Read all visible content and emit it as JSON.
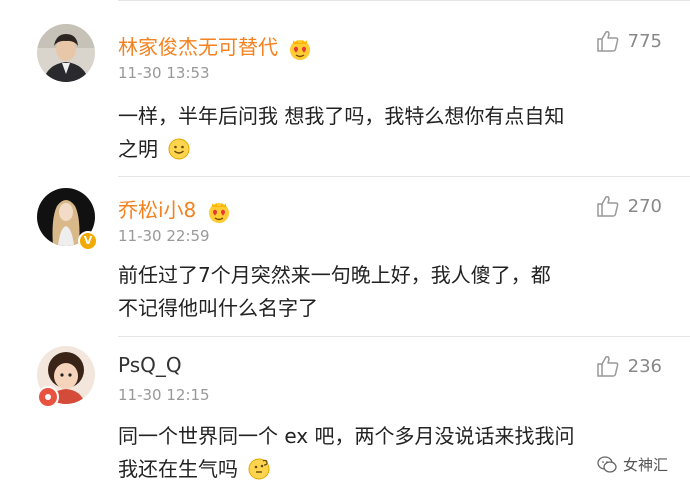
{
  "comments": [
    {
      "username": "林家俊杰无可替代",
      "timestamp": "11-30 13:53",
      "likes": "775",
      "lines": [
        "一样，半年后问我 想我了吗，我特么想你有点自知",
        "之明"
      ],
      "badge_icon": "heart-eyes-emoji-icon",
      "emoji_icon": "smile-emoji-icon",
      "avatar_icon": "user-photo-avatar"
    },
    {
      "username": "乔松i小8",
      "timestamp": "11-30 22:59",
      "likes": "270",
      "lines": [
        "前任过了7个月突然来一句晚上好，我人傻了，都",
        "不记得他叫什么名字了"
      ],
      "badge_icon": "heart-eyes-emoji-icon",
      "verified_badge": "V",
      "avatar_icon": "user-photo-avatar"
    },
    {
      "username": "PsQ_Q",
      "timestamp": "11-30 12:15",
      "likes": "236",
      "lines": [
        "同一个世界同一个 ex 吧，两个多月没说话来找我问",
        "我还在生气吗"
      ],
      "emoji_icon": "thinking-emoji-icon",
      "avatar_icon": "user-photo-avatar"
    }
  ],
  "watermark": {
    "label": "女神汇",
    "icon": "wechat-logo-icon"
  },
  "colors": {
    "username_highlight": "#f48220",
    "username_plain": "#333333",
    "timestamp": "#999999",
    "like": "#888888",
    "body_text": "#222222"
  }
}
